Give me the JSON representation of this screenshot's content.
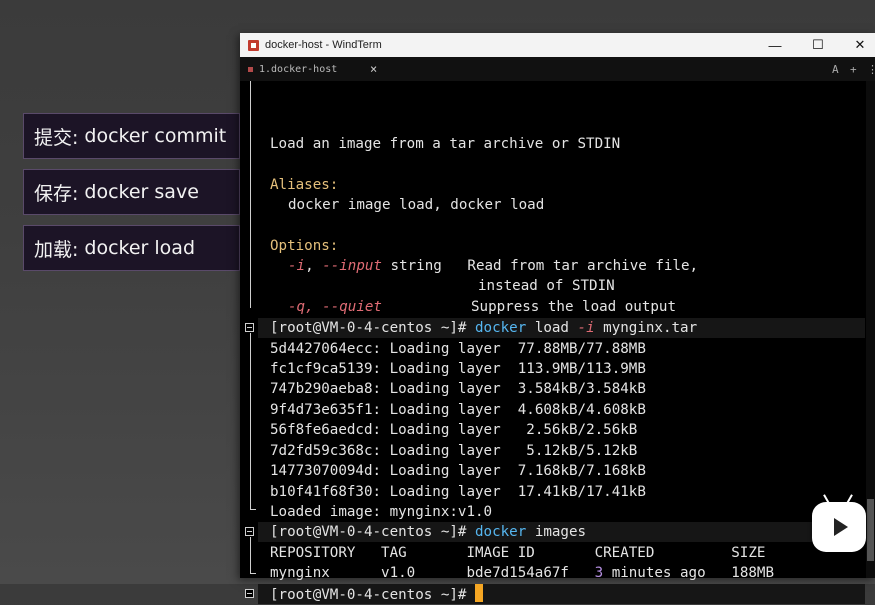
{
  "slide": {
    "labels": [
      {
        "prefix": "提交:",
        "text": "docker commit"
      },
      {
        "prefix": "保存:",
        "text": "docker save"
      },
      {
        "prefix": "加载:",
        "text": "docker load"
      }
    ]
  },
  "window": {
    "title": "docker-host - WindTerm",
    "controls": {
      "minimize": "—",
      "maximize": "☐",
      "close": "✕"
    }
  },
  "tabbar": {
    "tab_label": "1.docker-host",
    "tab_close": "×",
    "right_a": "A",
    "right_plus": "+",
    "right_more": "⋮"
  },
  "terminal": {
    "help": {
      "desc": "Load an image from a tar archive or STDIN",
      "aliases_label": "Aliases:",
      "aliases": "docker image load, docker load",
      "options_label": "Options:",
      "opt_i_short": "-i",
      "opt_i_long": "--input",
      "opt_i_type": "string",
      "opt_i_desc": "Read from tar archive file,",
      "opt_i_desc2": "instead of STDIN",
      "opt_q": "-q, --quiet",
      "opt_q_desc": "Suppress the load output"
    },
    "prompt": "[root@VM-0-4-centos ~]#",
    "cmd1": {
      "bin": "docker",
      "sub": "load",
      "flag": "-i",
      "arg": "mynginx.tar"
    },
    "layers": [
      {
        "id": "5d4427064ecc:",
        "status": "Loading layer",
        "size": "77.88MB/77.88MB"
      },
      {
        "id": "fc1cf9ca5139:",
        "status": "Loading layer",
        "size": "113.9MB/113.9MB"
      },
      {
        "id": "747b290aeba8:",
        "status": "Loading layer",
        "size": "3.584kB/3.584kB"
      },
      {
        "id": "9f4d73e635f1:",
        "status": "Loading layer",
        "size": "4.608kB/4.608kB"
      },
      {
        "id": "56f8fe6aedcd:",
        "status": "Loading layer",
        "size": " 2.56kB/2.56kB"
      },
      {
        "id": "7d2fd59c368c:",
        "status": "Loading layer",
        "size": " 5.12kB/5.12kB"
      },
      {
        "id": "14773070094d:",
        "status": "Loading layer",
        "size": "7.168kB/7.168kB"
      },
      {
        "id": "b10f41f68f30:",
        "status": "Loading layer",
        "size": "17.41kB/17.41kB"
      }
    ],
    "loaded_label": "Loaded image:",
    "loaded_name": "mynginx",
    "loaded_tag": ":v1.0",
    "cmd2": {
      "bin": "docker",
      "sub": "images"
    },
    "images_header": "REPOSITORY   TAG       IMAGE ID       CREATED         SIZE",
    "images_row": {
      "repo": "mynginx",
      "tag": "v1.0",
      "id": "bde7d154a67f",
      "created_num": "3",
      "created_rest": "minutes ago",
      "size": "188MB"
    }
  },
  "colors": {
    "accent_cursor": "#f5a623",
    "keyword_blue": "#56b6f0",
    "label_yellow": "#e5c07b",
    "option_red": "#e06c75"
  }
}
